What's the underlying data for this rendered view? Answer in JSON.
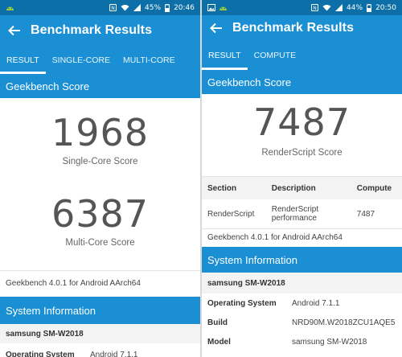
{
  "left": {
    "status": {
      "battery": "45%",
      "time": "20:46"
    },
    "title": "Benchmark Results",
    "tabs": [
      "RESULT",
      "SINGLE-CORE",
      "MULTI-CORE"
    ],
    "section_header": "Geekbench Score",
    "single_core": {
      "score": "1968",
      "label": "Single-Core Score"
    },
    "multi_core": {
      "score": "6387",
      "label": "Multi-Core Score"
    },
    "platform": "Geekbench 4.0.1 for Android AArch64",
    "system_header": "System Information",
    "device": "samsung SM-W2018",
    "os_label": "Operating System",
    "os_value": "Android 7.1.1"
  },
  "right": {
    "status": {
      "battery": "44%",
      "time": "20:50"
    },
    "title": "Benchmark Results",
    "tabs": [
      "RESULT",
      "COMPUTE"
    ],
    "section_header": "Geekbench Score",
    "score": "7487",
    "score_label": "RenderScript Score",
    "table_headers": [
      "Section",
      "Description",
      "Compute"
    ],
    "table_row": {
      "section": "RenderScript",
      "description": "RenderScript performance",
      "compute": "7487"
    },
    "platform": "Geekbench 4.0.1 for Android AArch64",
    "system_header": "System Information",
    "device": "samsung SM-W2018",
    "rows": [
      {
        "label": "Operating System",
        "value": "Android 7.1.1"
      },
      {
        "label": "Build",
        "value": "NRD90M.W2018ZCU1AQE5"
      },
      {
        "label": "Model",
        "value": "samsung SM-W2018"
      }
    ]
  },
  "colors": {
    "statusbar": "#0d6fa8",
    "primary": "#1a8fd4"
  }
}
